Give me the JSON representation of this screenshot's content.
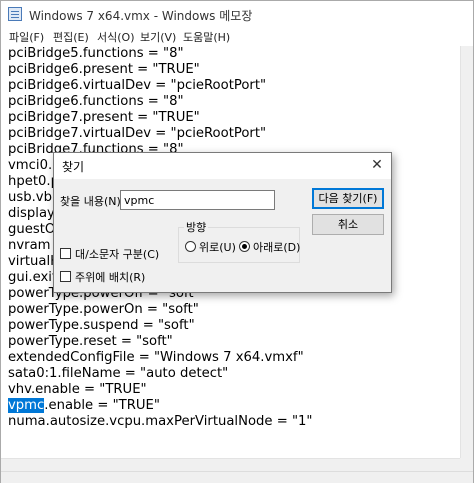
{
  "window": {
    "title": "Windows 7 x64.vmx - Windows 메모장"
  },
  "menu": [
    {
      "label": "파일(F)"
    },
    {
      "label": "편집(E)"
    },
    {
      "label": "서식(O)"
    },
    {
      "label": "보기(V)"
    },
    {
      "label": "도움말(H)"
    }
  ],
  "editor": {
    "lines": [
      "pciBridge5.functions = \"8\"",
      "pciBridge6.present = \"TRUE\"",
      "pciBridge6.virtualDev = \"pcieRootPort\"",
      "pciBridge6.functions = \"8\"",
      "pciBridge7.present = \"TRUE\"",
      "pciBridge7.virtualDev = \"pcieRootPort\"",
      "pciBridge7.functions = \"8\"",
      "vmci0.p",
      "hpet0.p",
      "usb.vbl",
      "displayN",
      "guestOS",
      "nvram =",
      "virtualH",
      "gui.exitOnCLIHLT = \"FALSE\"",
      "powerType.powerOff = \"soft\"",
      "powerType.powerOn = \"soft\"",
      "powerType.suspend = \"soft\"",
      "powerType.reset = \"soft\"",
      "extendedConfigFile = \"Windows 7 x64.vmxf\"",
      "sata0:1.fileName = \"auto detect\"",
      "vhv.enable = \"TRUE\"",
      "numa.autosize.vcpu.maxPerVirtualNode = \"1\""
    ],
    "selected_match": "vpmc",
    "selected_line_rest": ".enable = \"TRUE\""
  },
  "find_dialog": {
    "title": "찾기",
    "close_glyph": "✕",
    "find_label": "찾을 내용(N):",
    "find_value": "vpmc",
    "find_next_label": "다음 찾기(F)",
    "cancel_label": "취소",
    "direction_label": "방향",
    "up_label": "위로(U)",
    "down_label": "아래로(D)",
    "direction_selected": "down",
    "match_case_label": "대/소문자 구분(C)",
    "wrap_around_label": "주위에 배치(R)"
  }
}
